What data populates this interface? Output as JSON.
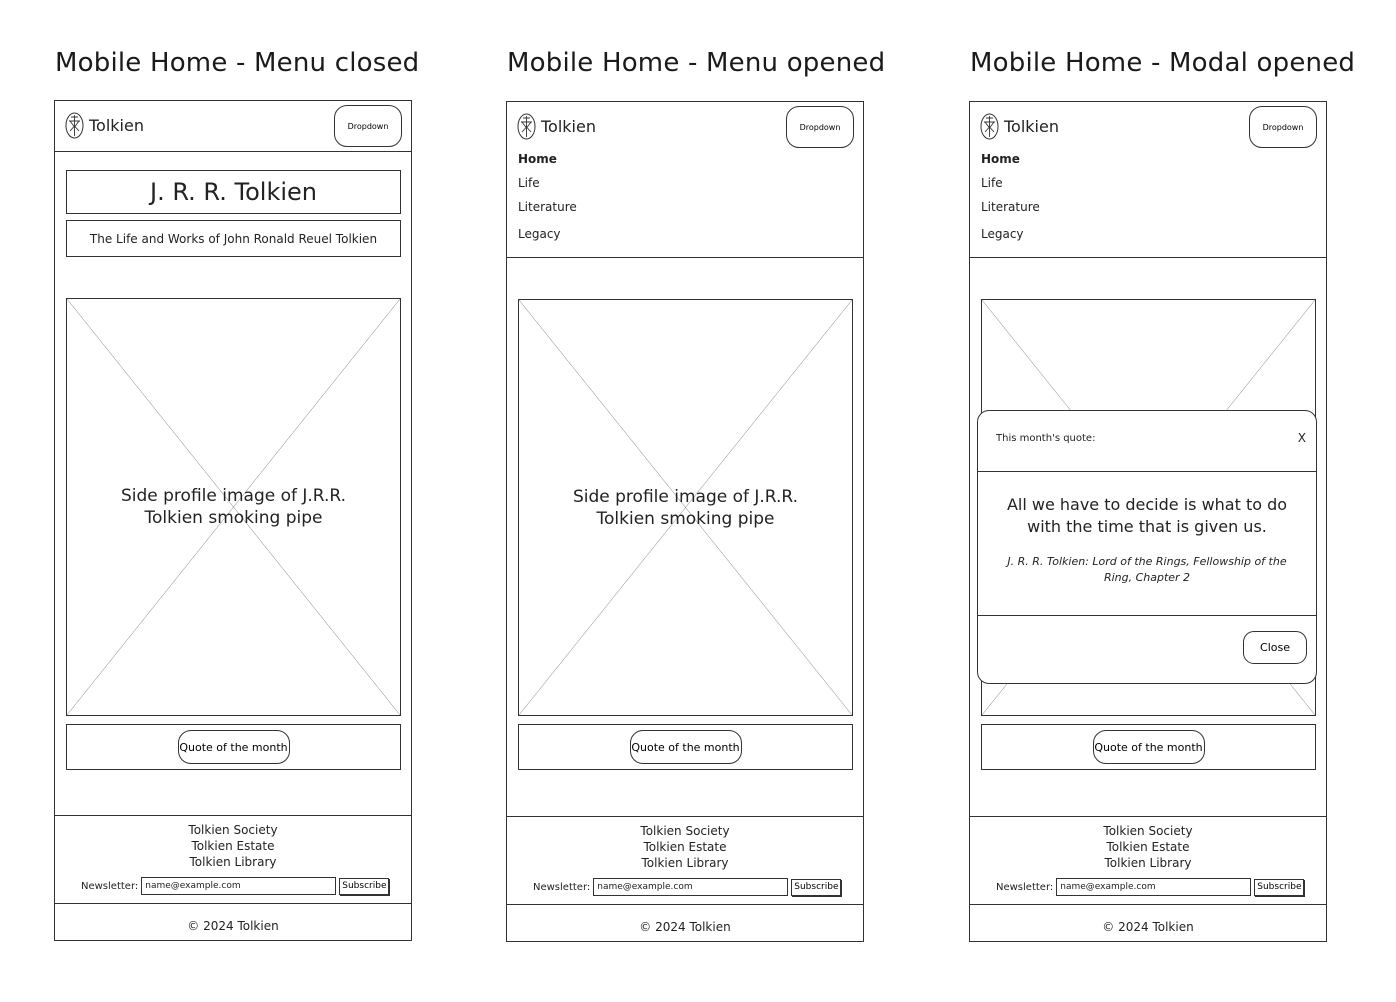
{
  "panels": [
    {
      "title": "Mobile Home - Menu closed"
    },
    {
      "title": "Mobile Home - Menu opened"
    },
    {
      "title": "Mobile Home - Modal opened"
    }
  ],
  "brand": "Tolkien",
  "logo_icon": "tolkien-monogram-icon",
  "dropdown_label": "Dropdown",
  "menu": [
    "Home",
    "Life",
    "Literature",
    "Legacy"
  ],
  "hero": {
    "title": "J. R. R. Tolkien",
    "subtitle": "The Life and Works of John Ronald Reuel Tolkien"
  },
  "image_placeholder": "Side profile image of J.R.R. Tolkien smoking pipe",
  "quote_button": "Quote of the month",
  "footer": {
    "links": [
      "Tolkien Society",
      "Tolkien Estate",
      "Tolkien Library"
    ],
    "newsletter_label": "Newsletter:",
    "newsletter_value": "name@example.com",
    "subscribe_label": "Subscribe",
    "copyright": "© 2024 Tolkien"
  },
  "modal": {
    "title": "This month's quote:",
    "close_x": "X",
    "quote": "All we have to decide is what to do with the time that is given us.",
    "citation": "J. R. R. Tolkien: Lord of the Rings, Fellowship of the Ring, Chapter 2",
    "close_label": "Close"
  }
}
